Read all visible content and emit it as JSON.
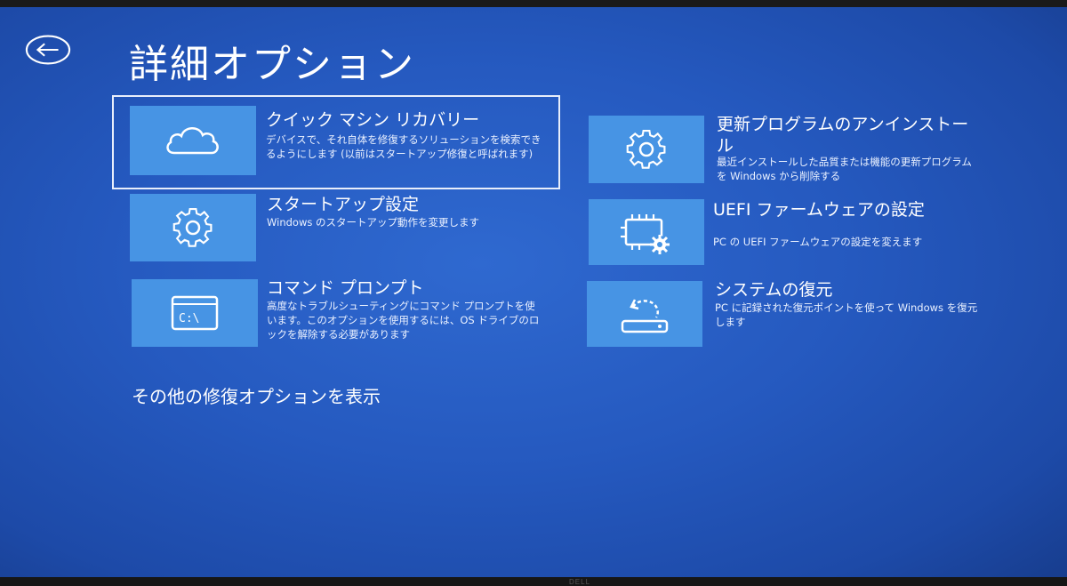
{
  "header": {
    "title": "詳細オプション"
  },
  "options": [
    {
      "title": "クイック マシン リカバリー",
      "description": "デバイスで、それ自体を修復するソリューションを検索できるようにします (以前はスタートアップ修復と呼ばれます)",
      "icon": "cloud-icon"
    },
    {
      "title": "スタートアップ設定",
      "description": "Windows のスタートアップ動作を変更します",
      "icon": "gear-icon"
    },
    {
      "title": "コマンド プロンプト",
      "description": "高度なトラブルシューティングにコマンド プロンプトを使います。このオプションを使用するには、OS ドライブのロックを解除する必要があります",
      "icon": "command-prompt-icon"
    },
    {
      "title": "更新プログラムのアンインストール",
      "description": "最近インストールした品質または機能の更新プログラムを Windows から削除する",
      "icon": "gear-icon"
    },
    {
      "title": "UEFI ファームウェアの設定",
      "description": "PC の UEFI ファームウェアの設定を変えます",
      "icon": "chip-gear-icon"
    },
    {
      "title": "システムの復元",
      "description": "PC に記録された復元ポイントを使って Windows を復元します",
      "icon": "restore-icon"
    }
  ],
  "footer": {
    "more_options": "その他の修復オプションを表示"
  },
  "monitor": {
    "brand": "DELL"
  },
  "colors": {
    "background": "#2559bf",
    "tile": "#4794e4",
    "text": "#ffffff"
  }
}
